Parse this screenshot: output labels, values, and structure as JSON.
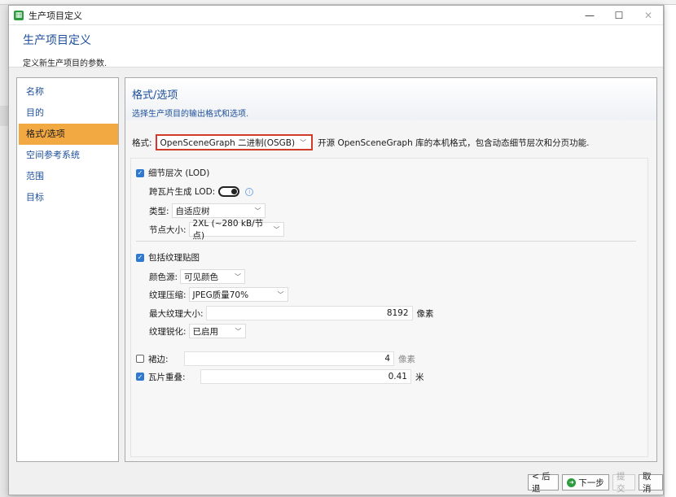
{
  "window": {
    "title": "生产项目定义"
  },
  "header": {
    "title": "生产项目定义",
    "subtitle": "定义新生产项目的参数."
  },
  "nav": {
    "items": [
      "名称",
      "目的",
      "格式/选项",
      "空间参考系统",
      "范围",
      "目标"
    ],
    "active": "格式/选项"
  },
  "content": {
    "title": "格式/选项",
    "subtitle": "选择生产项目的输出格式和选项.",
    "format_label": "格式:",
    "format_value": "OpenSceneGraph 二进制(OSGB)",
    "format_desc": "开源 OpenSceneGraph 库的本机格式，包含动态细节层次和分页功能."
  },
  "lod": {
    "checkbox_label": "细节层次 (LOD)",
    "checked": true,
    "cross_tile_label": "跨瓦片生成 LOD:",
    "cross_tile_on": false,
    "type_label": "类型:",
    "type_value": "自适应树",
    "node_size_label": "节点大小:",
    "node_size_value": "2XL (~280 kB/节点)"
  },
  "texture": {
    "checkbox_label": "包括纹理贴图",
    "checked": true,
    "color_source_label": "颜色源:",
    "color_source_value": "可见颜色",
    "compression_label": "纹理压缩:",
    "compression_value": "JPEG质量70%",
    "max_size_label": "最大纹理大小:",
    "max_size_value": "8192",
    "max_size_unit": "像素",
    "sharpen_label": "纹理锐化:",
    "sharpen_value": "已启用"
  },
  "skirt": {
    "label": "裙边:",
    "checked": false,
    "value": "4",
    "unit": "像素"
  },
  "overlap": {
    "label": "瓦片重叠:",
    "checked": true,
    "value": "0.41",
    "unit": "米"
  },
  "footer": {
    "back": "< 后退",
    "next": "下一步",
    "submit": "提交",
    "cancel": "取消"
  },
  "icons": {
    "app": "app-icon",
    "info": "info-icon",
    "next": "next-arrow-icon"
  },
  "colors": {
    "accent": "#2f79d1",
    "nav_active": "#f2a941",
    "highlight_border": "#d23a2a",
    "title_blue": "#1d4f9a"
  }
}
